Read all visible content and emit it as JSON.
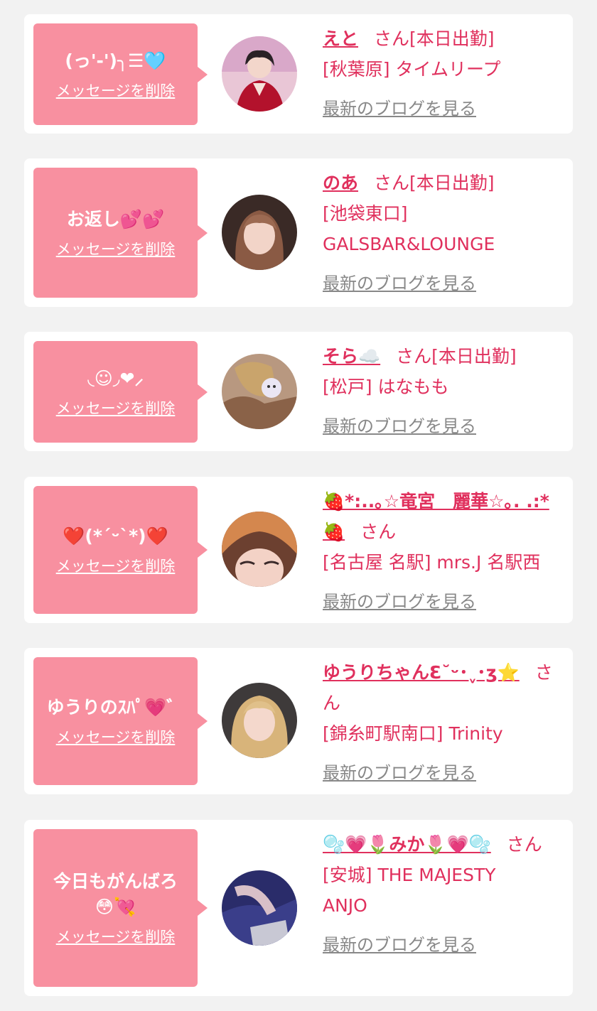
{
  "entries": [
    {
      "message": "(っ'-')╮☰🩵",
      "delete_label": "メッセージを削除",
      "name": "えと",
      "honorific": "さん",
      "status": "[本日出勤]",
      "location": "[秋葉原] タイムリープ",
      "blog_label": "最新のブログを見る",
      "avatar": "photo-avatar-pink-kimono"
    },
    {
      "message": "お返し💕💕",
      "delete_label": "メッセージを削除",
      "name": "のあ",
      "honorific": "さん",
      "status": "[本日出勤]",
      "location": "[池袋東口] GALSBAR&LOUNGE",
      "blog_label": "最新のブログを見る",
      "avatar": "photo-avatar-brown-hair"
    },
    {
      "message": "◟☺︎◞❤︎⸝",
      "delete_label": "メッセージを削除",
      "name": "そら☁️",
      "honorific": "さん",
      "status": "[本日出勤]",
      "location": "[松戸] はなもも",
      "blog_label": "最新のブログを見る",
      "avatar": "photo-avatar-sticker-face"
    },
    {
      "message": "❤️(*´ᵕ`*)❤️",
      "delete_label": "メッセージを削除",
      "name": "🍓*:..｡☆竜宮　麗華☆｡. .:*🍓",
      "honorific": "さん",
      "status": "",
      "location": "[名古屋 名駅] mrs.J 名駅西",
      "blog_label": "最新のブログを見る",
      "avatar": "photo-avatar-orange-hair"
    },
    {
      "message": "ゆうりのｽﾊﾟ💗゛",
      "delete_label": "メッセージを削除",
      "name": "ゆうりちゃんƐ˘ᵕ･ˬ･ʒ⭐️",
      "honorific": "さん",
      "status": "",
      "location": "[錦糸町駅南口] Trinity",
      "blog_label": "最新のブログを見る",
      "avatar": "photo-avatar-blonde"
    },
    {
      "message": "今日もがんばろ😳💘",
      "delete_label": "メッセージを削除",
      "name": "🫧💗🌷みか🌷💗🫧",
      "honorific": "さん",
      "status": "",
      "location": "[安城] THE MAJESTY ANJO",
      "blog_label": "最新のブログを見る",
      "avatar": "photo-avatar-dark"
    }
  ]
}
